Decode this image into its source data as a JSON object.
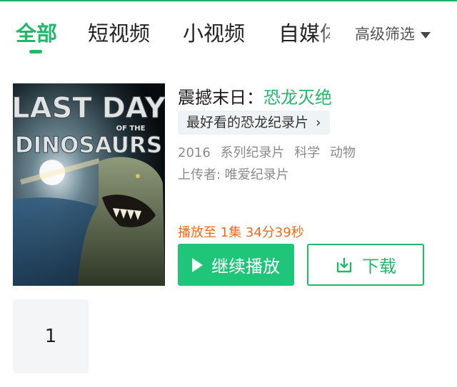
{
  "tabs": [
    {
      "label": "全部",
      "active": true
    },
    {
      "label": "短视频",
      "active": false
    },
    {
      "label": "小视频",
      "active": false
    },
    {
      "label": "自媒体",
      "active": false
    }
  ],
  "filter": {
    "label": "高级筛选",
    "icon": "caret-down-icon"
  },
  "poster": {
    "line1": "LAST DAY",
    "line2": "OF THE",
    "line3": "DINOSAURS"
  },
  "result": {
    "title_prefix": "震撼末日：",
    "title_highlight": "恐龙灭绝",
    "tag": "最好看的恐龙纪录片",
    "meta": {
      "year": "2016",
      "type": "系列纪录片",
      "genre1": "科学",
      "genre2": "动物"
    },
    "uploader": "上传者: 唯爱纪录片",
    "progress": "播放至 1集 34分39秒",
    "play_label": "继续播放",
    "download_label": "下载"
  },
  "episodes": [
    "1"
  ],
  "colors": {
    "accent": "#21b86a",
    "play_bg": "#1fc67a",
    "progress": "#f06a1b"
  }
}
